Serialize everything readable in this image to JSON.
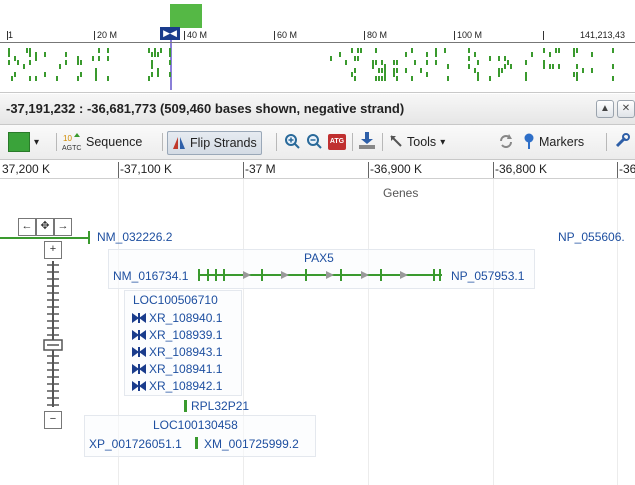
{
  "overview": {
    "tick_labels": [
      "1",
      "20 M",
      "40 M",
      "60 M",
      "80 M",
      "100 M",
      "141,213,43"
    ],
    "marker_icon": "position-marker-icon"
  },
  "header": {
    "range_text": "-37,191,232 : -36,681,773 (509,460 bases shown, negative strand)",
    "up_icon": "▲",
    "close_icon": "✕"
  },
  "toolbar": {
    "color_swatch": "#3aa33a",
    "sequence_label": "Sequence",
    "flip_strands_label": "Flip Strands",
    "tools_label": "Tools",
    "markers_label": "Markers",
    "dropdown_arrow": "▾"
  },
  "ruler": {
    "labels": [
      "37,200 K",
      "-37,100 K",
      "-37 M",
      "-36,900 K",
      "-36,800 K",
      "-36"
    ]
  },
  "tracks": {
    "title": "Genes",
    "nav": {
      "left": "←",
      "center": "✥",
      "right": "→",
      "zoom_in": "+",
      "zoom_out": "−"
    },
    "genes": {
      "nm_032226": "NM_032226.2",
      "np_055606": "NP_055606.",
      "pax5": "PAX5",
      "nm_016734": "NM_016734.1",
      "np_057953": "NP_057953.1",
      "loc100506710": "LOC100506710",
      "xr_list": [
        "XR_108940.1",
        "XR_108939.1",
        "XR_108943.1",
        "XR_108941.1",
        "XR_108942.1"
      ],
      "rpl32p21": "RPL32P21",
      "loc100130458": "LOC100130458",
      "xp_001726051": "XP_001726051.1",
      "xm_001725999": "XM_001725999.2"
    }
  },
  "colors": {
    "gene_green": "#3a9a2e",
    "label_blue": "#1e4fa0",
    "marker_blue": "#1a3c8c",
    "overview_green": "#55b845"
  }
}
